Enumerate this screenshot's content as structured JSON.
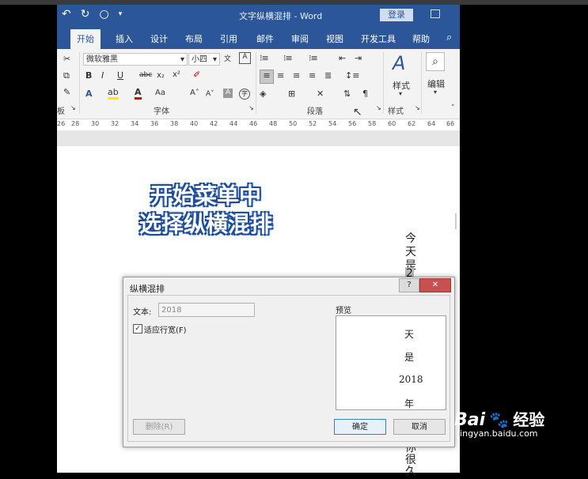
{
  "window": {
    "title": "文字纵横混排 - Word",
    "login": "登录"
  },
  "tabs": [
    "开始",
    "插入",
    "设计",
    "布局",
    "引用",
    "邮件",
    "审阅",
    "视图",
    "开发工具",
    "帮助"
  ],
  "ribbon": {
    "font_name": "微软雅黑",
    "font_size": "小四",
    "groups": {
      "font": "字体",
      "paragraph": "段落",
      "styles": "样式"
    },
    "styles_button": "样式",
    "edit_button": "编辑",
    "partial_group": "板"
  },
  "ruler": [
    26,
    28,
    30,
    32,
    34,
    36,
    38,
    40,
    42,
    44,
    46,
    48,
    50,
    52,
    54,
    56,
    58,
    60,
    62,
    64,
    66
  ],
  "overlay": {
    "line1": "开始菜单中",
    "line2": "选择纵横混排"
  },
  "document": {
    "vertical_text": [
      "今",
      "天",
      "是",
      "2"
    ],
    "bottom_text": [
      "你",
      "很",
      "久"
    ]
  },
  "dialog": {
    "title": "纵横混排",
    "help": "?",
    "close": "✕",
    "text_label": "文本:",
    "text_value": "2018",
    "fit_label": "适应行宽(F)",
    "fit_checked": true,
    "preview_label": "预览",
    "preview_lines": [
      "天",
      "是",
      "2018",
      "年"
    ],
    "delete_button": "删除(R)",
    "ok_button": "确定",
    "cancel_button": "取消"
  },
  "watermark": {
    "brand": "Bai",
    "cn": "经验",
    "url": "jingyan.baidu.com"
  }
}
